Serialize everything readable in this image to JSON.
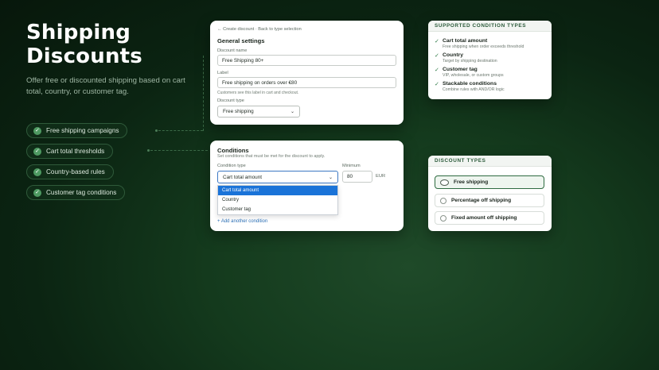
{
  "hero": {
    "title_line1": "Shipping",
    "title_line2": "Discounts",
    "subtitle": "Offer free or discounted shipping based on cart total, country, or customer tag."
  },
  "features": [
    {
      "label": "Free shipping campaigns"
    },
    {
      "label": "Cart total thresholds"
    },
    {
      "label": "Country-based rules"
    },
    {
      "label": "Customer tag conditions"
    }
  ],
  "general": {
    "breadcrumb": "← Create discount · Back to type selection",
    "title": "General settings",
    "name_label": "Discount name",
    "name_value": "Free Shipping 80+",
    "label_label": "Label",
    "label_value": "Free shipping on orders over €80",
    "label_help": "Customers see this label in cart and checkout.",
    "type_label": "Discount type",
    "type_value": "Free shipping"
  },
  "conditions": {
    "title": "Conditions",
    "subtitle": "Set conditions that must be met for the discount to apply.",
    "type_label": "Condition type",
    "type_value": "Cart total amount",
    "min_label": "Minimum",
    "min_value": "80",
    "currency": "EUR",
    "options": [
      "Cart total amount",
      "Country",
      "Customer tag"
    ],
    "add_link": "+ Add another condition"
  },
  "supported": {
    "header": "SUPPORTED CONDITION TYPES",
    "items": [
      {
        "title": "Cart total amount",
        "desc": "Free shipping when order exceeds threshold"
      },
      {
        "title": "Country",
        "desc": "Target by shipping destination"
      },
      {
        "title": "Customer tag",
        "desc": "VIP, wholesale, or custom groups"
      },
      {
        "title": "Stackable conditions",
        "desc": "Combine rules with AND/OR logic"
      }
    ]
  },
  "discount_types": {
    "header": "DISCOUNT TYPES",
    "options": [
      {
        "label": "Free shipping",
        "selected": true
      },
      {
        "label": "Percentage off shipping",
        "selected": false
      },
      {
        "label": "Fixed amount off shipping",
        "selected": false
      }
    ]
  },
  "colors": {
    "accent": "#2e6b40",
    "check": "#4e9a62",
    "link": "#2c6fb5",
    "dropdown_selected": "#1a73d8"
  }
}
